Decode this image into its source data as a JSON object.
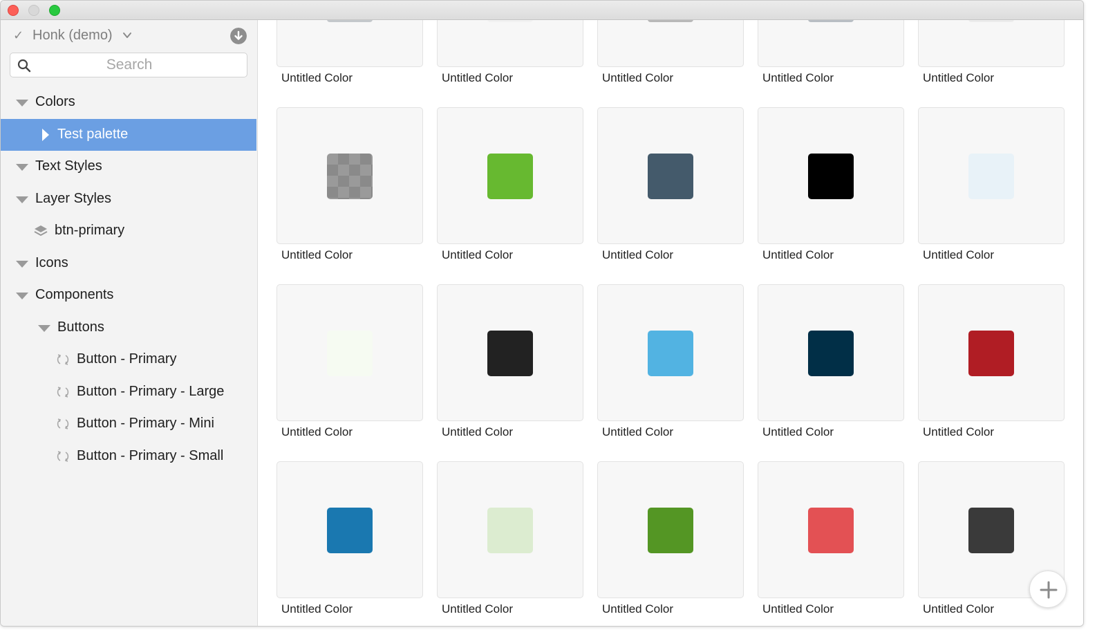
{
  "library": {
    "check_glyph": "✓",
    "name": "Honk (demo)",
    "icons": {
      "chevron": "chevron-down-icon",
      "download": "download-icon"
    }
  },
  "search": {
    "placeholder": "Search",
    "value": ""
  },
  "tree": {
    "colors": "Colors",
    "test_palette": "Test palette",
    "text_styles": "Text Styles",
    "layer_styles": "Layer Styles",
    "btn_primary": "btn-primary",
    "icons": "Icons",
    "components": "Components",
    "buttons": "Buttons",
    "button_primary": "Button - Primary",
    "button_primary_large": "Button - Primary - Large",
    "button_primary_mini": "Button - Primary - Mini",
    "button_primary_small": "Button - Primary - Small"
  },
  "colors": {
    "partial_row": [
      {
        "label": "Untitled Color",
        "hex": "#c4c8cc"
      },
      {
        "label": "Untitled Color",
        "hex": "#f2f2f2"
      },
      {
        "label": "Untitled Color",
        "hex": "#b8b8b8"
      },
      {
        "label": "Untitled Color",
        "hex": "#b8bec4"
      },
      {
        "label": "Untitled Color",
        "hex": "#ececec"
      }
    ],
    "rows": [
      [
        {
          "label": "Untitled Color",
          "hex": "#9a9a9a",
          "pattern": "checker"
        },
        {
          "label": "Untitled Color",
          "hex": "#67b930"
        },
        {
          "label": "Untitled Color",
          "hex": "#445a6b"
        },
        {
          "label": "Untitled Color",
          "hex": "#000000"
        },
        {
          "label": "Untitled Color",
          "hex": "#e8f2f8"
        }
      ],
      [
        {
          "label": "Untitled Color",
          "hex": "#f6fbf2"
        },
        {
          "label": "Untitled Color",
          "hex": "#222222"
        },
        {
          "label": "Untitled Color",
          "hex": "#52b3e2"
        },
        {
          "label": "Untitled Color",
          "hex": "#012f47"
        },
        {
          "label": "Untitled Color",
          "hex": "#b01d24"
        }
      ],
      [
        {
          "label": "Untitled Color",
          "hex": "#1a78b0"
        },
        {
          "label": "Untitled Color",
          "hex": "#dcecd0"
        },
        {
          "label": "Untitled Color",
          "hex": "#549624"
        },
        {
          "label": "Untitled Color",
          "hex": "#e35154"
        },
        {
          "label": "Untitled Color",
          "hex": "#3a3a3a"
        }
      ]
    ]
  },
  "selection_color": "#6b9fe3",
  "add_button": {
    "icon": "plus-icon"
  }
}
